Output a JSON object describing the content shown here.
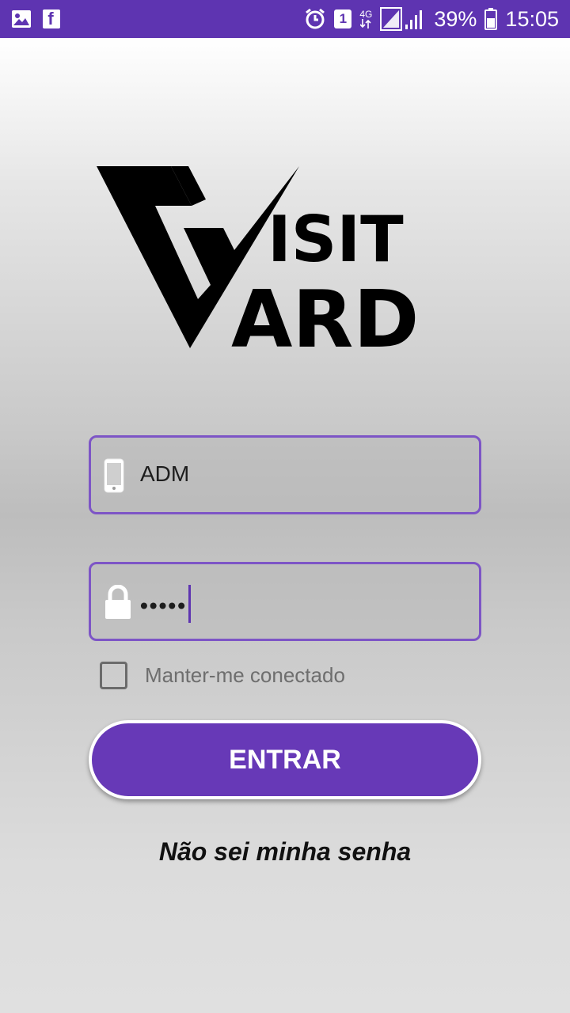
{
  "status_bar": {
    "battery_percent": "39%",
    "time": "15:05",
    "network_type": "4G",
    "sim_slot": "1",
    "left_icons": [
      "gallery-icon",
      "facebook-icon"
    ],
    "right_icons": [
      "alarm-icon",
      "sim-icon",
      "network-icon",
      "signal-icon",
      "battery-icon"
    ],
    "color": "#5e34b1"
  },
  "logo": {
    "line1": "ISIT",
    "line2": "ARD",
    "icon": "visit-card-logo"
  },
  "login": {
    "username": {
      "value": "ADM",
      "icon": "phone-icon"
    },
    "password": {
      "value": "•••••",
      "icon": "lock-icon"
    },
    "remember_label": "Manter-me conectado",
    "remember_checked": false,
    "submit_label": "ENTRAR",
    "forgot_label": "Não sei minha senha"
  },
  "colors": {
    "accent": "#6739b7",
    "field_border": "#7d55c6"
  }
}
